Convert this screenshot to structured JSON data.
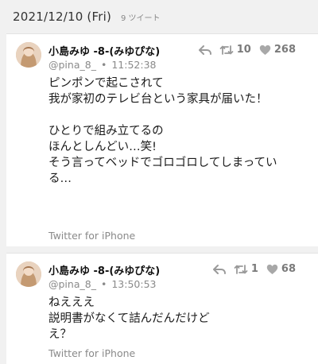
{
  "header": {
    "date": "2021/12/10 (Fri)",
    "tweet_count": "9 ツイート"
  },
  "tweets": [
    {
      "author": "小島みゆ -8-(みゆぴな)",
      "handle": "@pina_8_",
      "time": "11:52:38",
      "retweets": "10",
      "likes": "268",
      "lines": [
        "ピンポンで起こされて",
        "我が家初のテレビ台という家具が届いた！",
        "",
        "ひとりで組み立てるの",
        "ほんとしんどい…笑!",
        "そう言ってベッドでゴロゴロしてしまってい",
        "る…"
      ],
      "source": "Twitter for iPhone"
    },
    {
      "author": "小島みゆ -8-(みゆぴな)",
      "handle": "@pina_8_",
      "time": "13:50:53",
      "retweets": "1",
      "likes": "68",
      "lines": [
        "ねえええ",
        "説明書がなくて詰んだんだけど",
        "え？"
      ],
      "source": "Twitter for iPhone"
    }
  ],
  "icons": [
    "reply-icon",
    "retweet-icon",
    "like-icon"
  ]
}
